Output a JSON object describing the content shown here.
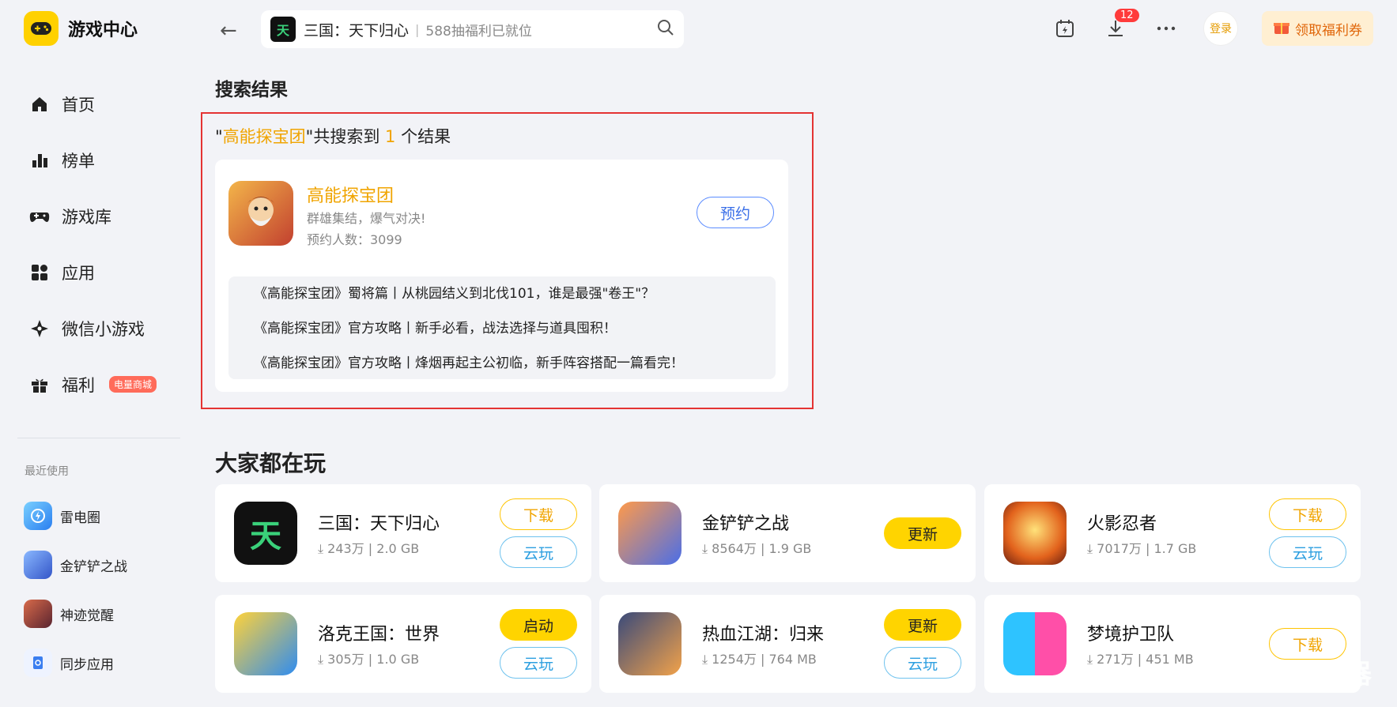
{
  "app": {
    "title": "游戏中心"
  },
  "nav": [
    {
      "label": "首页",
      "icon": "home-icon"
    },
    {
      "label": "榜单",
      "icon": "chart-icon"
    },
    {
      "label": "游戏库",
      "icon": "gamepad-icon"
    },
    {
      "label": "应用",
      "icon": "apps-icon"
    },
    {
      "label": "微信小游戏",
      "icon": "sparkle-icon"
    },
    {
      "label": "福利",
      "icon": "gift-icon",
      "badge": "电量商城"
    }
  ],
  "recent": {
    "title": "最近使用",
    "items": [
      "雷电圈",
      "金铲铲之战",
      "神迹觉醒",
      "同步应用"
    ]
  },
  "search": {
    "game_title": "三国：天下归心",
    "placeholder": "588抽福利已就位"
  },
  "topbar": {
    "download_badge": "12",
    "login": "登录",
    "coupon": "领取福利券"
  },
  "results": {
    "heading": "搜索结果",
    "query": "高能探宝团",
    "prefix_quote": "\"",
    "mid_text": "\"共搜索到 ",
    "count": "1",
    "suffix": " 个结果",
    "card": {
      "name": "高能探宝团",
      "desc": "群雄集结，爆气对决!",
      "count": "预约人数：3099",
      "action": "预约",
      "articles": [
        "《高能探宝团》蜀将篇丨从桃园结义到北伐101，谁是最强\"卷王\"？",
        "《高能探宝团》官方攻略丨新手必看，战法选择与道具囤积！",
        "《高能探宝团》官方攻略丨烽烟再起主公初临，新手阵容搭配一篇看完！"
      ]
    }
  },
  "popular": {
    "heading": "大家都在玩",
    "games": [
      {
        "name": "三国：天下归心",
        "downloads": "243万",
        "size": "2.0 GB",
        "buttons": [
          "下载",
          "云玩"
        ]
      },
      {
        "name": "金铲铲之战",
        "downloads": "8564万",
        "size": "1.9 GB",
        "buttons": [
          "更新"
        ]
      },
      {
        "name": "火影忍者",
        "downloads": "7017万",
        "size": "1.7 GB",
        "buttons": [
          "下载",
          "云玩"
        ]
      },
      {
        "name": "洛克王国：世界",
        "downloads": "305万",
        "size": "1.0 GB",
        "buttons": [
          "启动",
          "云玩"
        ]
      },
      {
        "name": "热血江湖：归来",
        "downloads": "1254万",
        "size": "764 MB",
        "buttons": [
          "更新",
          "云玩"
        ]
      },
      {
        "name": "梦境护卫队",
        "downloads": "271万",
        "size": "451 MB",
        "buttons": [
          "下载"
        ]
      }
    ]
  },
  "watermark": "雷电模拟器",
  "colors": {
    "accent": "#ffd400",
    "highlight": "#f0a400",
    "blue": "#2d9fe0",
    "red_box": "#e43333"
  }
}
